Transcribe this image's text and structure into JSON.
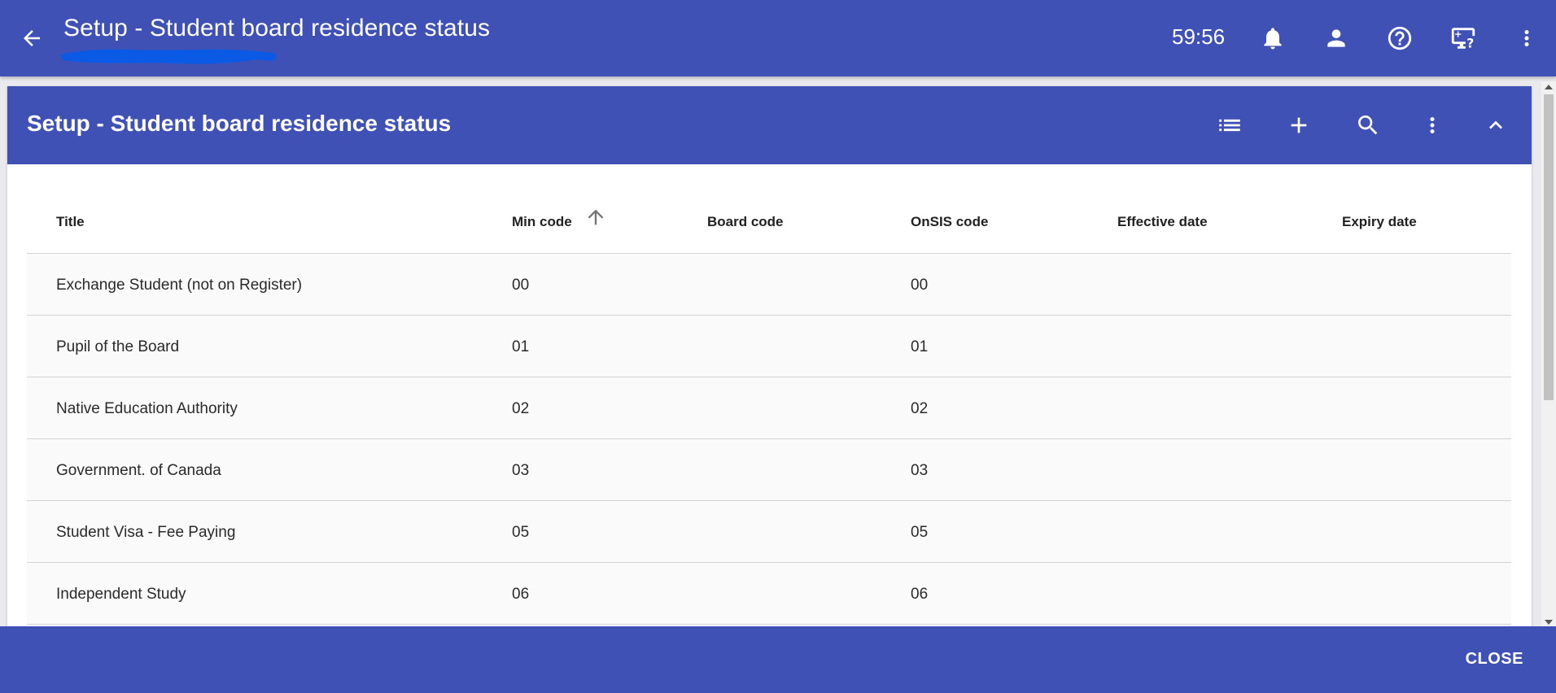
{
  "topbar": {
    "title": "Setup - Student board residence status",
    "timer": "59:56",
    "icons": [
      "back-arrow-icon",
      "bell-icon",
      "person-icon",
      "help-icon",
      "remote-help-icon",
      "more-vert-icon"
    ]
  },
  "panel": {
    "title": "Setup - Student board residence status",
    "icons": [
      "list-icon",
      "add-icon",
      "search-icon",
      "more-vert-icon",
      "chevron-up-icon"
    ]
  },
  "table": {
    "columns": [
      "Title",
      "Min code",
      "Board code",
      "OnSIS code",
      "Effective date",
      "Expiry date"
    ],
    "sorted_column": "Min code",
    "sort_direction": "ascending",
    "rows": [
      {
        "title": "Exchange Student (not on Register)",
        "min_code": "00",
        "board_code": "",
        "onsis_code": "00",
        "effective_date": "",
        "expiry_date": ""
      },
      {
        "title": "Pupil of the Board",
        "min_code": "01",
        "board_code": "",
        "onsis_code": "01",
        "effective_date": "",
        "expiry_date": ""
      },
      {
        "title": "Native Education Authority",
        "min_code": "02",
        "board_code": "",
        "onsis_code": "02",
        "effective_date": "",
        "expiry_date": ""
      },
      {
        "title": "Government. of Canada",
        "min_code": "03",
        "board_code": "",
        "onsis_code": "03",
        "effective_date": "",
        "expiry_date": ""
      },
      {
        "title": "Student Visa - Fee Paying",
        "min_code": "05",
        "board_code": "",
        "onsis_code": "05",
        "effective_date": "",
        "expiry_date": ""
      },
      {
        "title": "Independent Study",
        "min_code": "06",
        "board_code": "",
        "onsis_code": "06",
        "effective_date": "",
        "expiry_date": ""
      }
    ]
  },
  "footer": {
    "close_label": "CLOSE"
  },
  "colors": {
    "primary": "#3f51b5",
    "row_background": "#fafafa",
    "redaction": "#0a5ae6"
  }
}
